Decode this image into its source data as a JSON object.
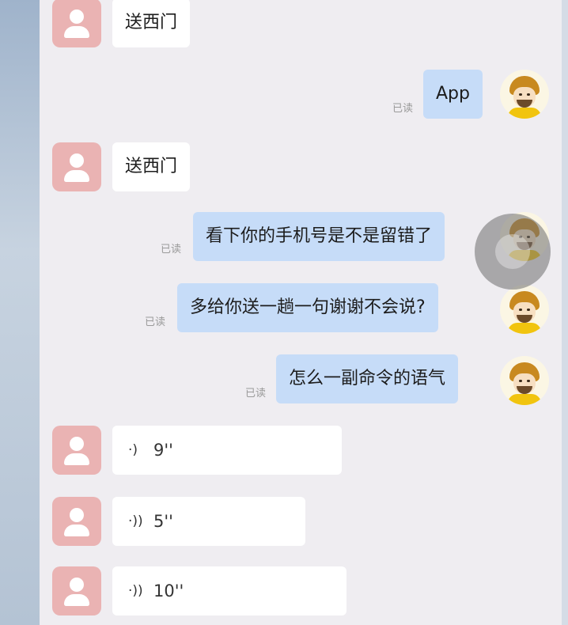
{
  "messages": [
    {
      "side": "in",
      "kind": "text",
      "text": "送西门"
    },
    {
      "side": "out",
      "kind": "text",
      "text": "App",
      "read": "已读"
    },
    {
      "side": "in",
      "kind": "text",
      "text": "送西门"
    },
    {
      "side": "out",
      "kind": "text",
      "text": "看下你的手机号是不是留错了",
      "read": "已读"
    },
    {
      "side": "out",
      "kind": "text",
      "text": "多给你送一趟一句谢谢不会说?",
      "read": "已读"
    },
    {
      "side": "out",
      "kind": "text",
      "text": "怎么一副命令的语气",
      "read": "已读"
    },
    {
      "side": "in",
      "kind": "voice",
      "text": "9''"
    },
    {
      "side": "in",
      "kind": "voice",
      "text": "5''"
    },
    {
      "side": "in",
      "kind": "voice",
      "text": "10''"
    }
  ],
  "icons": {
    "voice": "voice-wave-icon",
    "customer_avatar": "person-avatar-icon",
    "rider_avatar": "rider-avatar-icon",
    "floating": "assistive-touch-icon"
  },
  "colors": {
    "incoming_bubble": "#ffffff",
    "outgoing_bubble": "#c6dcf8",
    "customer_avatar_bg": "#eab3b3",
    "chat_bg": "#efedf1"
  }
}
